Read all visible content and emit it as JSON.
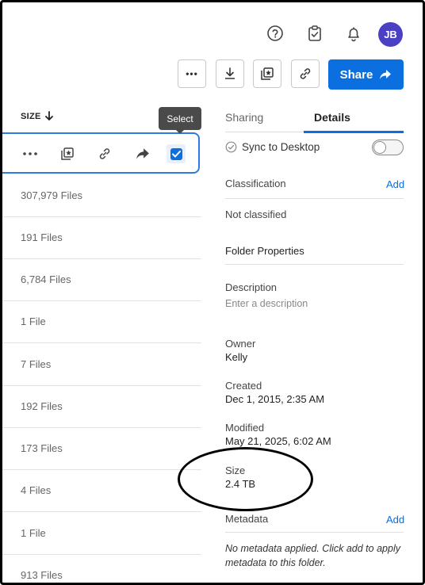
{
  "topbar": {
    "help_icon": "question-circle-icon",
    "tasks_icon": "clipboard-check-icon",
    "notifications_icon": "bell-icon",
    "avatar_initials": "JB",
    "avatar_color": "#4b3fc4"
  },
  "actions": {
    "more_label": "•••",
    "share_label": "Share"
  },
  "list": {
    "column_header": "SIZE",
    "tooltip": "Select",
    "rows": [
      "307,979 Files",
      "191 Files",
      "6,784 Files",
      "1 File",
      "7 Files",
      "192 Files",
      "173 Files",
      "4 Files",
      "1 File",
      "913 Files"
    ]
  },
  "panel": {
    "tabs": [
      "Sharing",
      "Details"
    ],
    "active_tab": "Details",
    "sync_label": "Sync to Desktop",
    "classification_label": "Classification",
    "classification_add": "Add",
    "classification_value": "Not classified",
    "folder_properties": "Folder Properties",
    "description_label": "Description",
    "description_placeholder": "Enter a description",
    "owner_label": "Owner",
    "owner_value": "Kelly",
    "created_label": "Created",
    "created_value": "Dec 1, 2015, 2:35 AM",
    "modified_label": "Modified",
    "modified_value": "May 21, 2025, 6:02 AM",
    "size_label": "Size",
    "size_value": "2.4 TB",
    "metadata_label": "Metadata",
    "metadata_add": "Add",
    "metadata_note": "No metadata applied. Click add to apply metadata to this folder."
  },
  "colors": {
    "accent": "#0b6fe0"
  }
}
